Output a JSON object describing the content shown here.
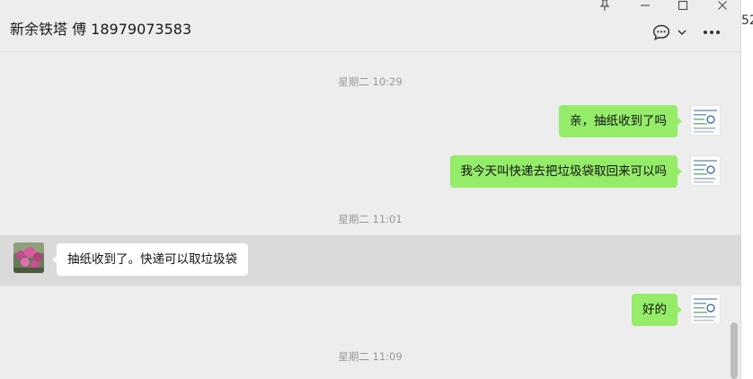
{
  "header": {
    "title": "新余铁塔 傅 18979073583",
    "icons": [
      "pin-icon",
      "minimize-icon",
      "maximize-icon",
      "close-icon",
      "chat-bubble-icon",
      "chevron-down-icon",
      "more-icon"
    ]
  },
  "messages": [
    {
      "type": "time",
      "text": "星期二 10:29"
    },
    {
      "type": "message",
      "sender": "me",
      "text": "亲，抽纸收到了吗"
    },
    {
      "type": "message",
      "sender": "me",
      "text": "我今天叫快递去把垃圾袋取回来可以吗"
    },
    {
      "type": "time",
      "text": "星期二 11:01"
    },
    {
      "type": "message",
      "sender": "contact",
      "text": "抽纸收到了。快递可以取垃圾袋"
    },
    {
      "type": "message",
      "sender": "me",
      "text": "好的"
    },
    {
      "type": "time",
      "text": "星期二 11:09"
    }
  ],
  "side_panel": {
    "text": "52"
  },
  "colors": {
    "window_bg": "#ededed",
    "my_bubble": "#95ec69",
    "their_bubble": "#ffffff",
    "highlight_row": "#dadada",
    "timestamp": "#9a9a9a"
  }
}
